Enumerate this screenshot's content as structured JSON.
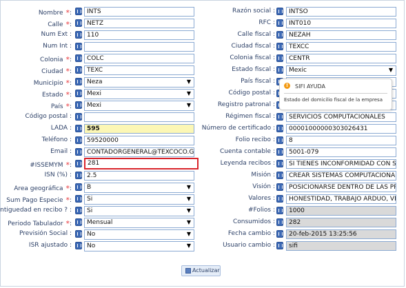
{
  "left": [
    {
      "label": "Nombre",
      "required": true,
      "type": "text",
      "value": "INTS"
    },
    {
      "label": "Calle",
      "required": true,
      "type": "text",
      "value": "NETZ"
    },
    {
      "label": "Num Ext",
      "required": false,
      "type": "text",
      "value": "110"
    },
    {
      "label": "Num Int",
      "required": false,
      "type": "text",
      "value": ""
    },
    {
      "label": "Colonia",
      "required": true,
      "type": "text",
      "value": "COLC"
    },
    {
      "label": "Ciudad",
      "required": true,
      "type": "text",
      "value": "TEXC"
    },
    {
      "label": "Municipio",
      "required": true,
      "type": "select",
      "value": "Neza"
    },
    {
      "label": "Estado",
      "required": true,
      "type": "select",
      "value": "Mexi"
    },
    {
      "label": "País",
      "required": true,
      "type": "select",
      "value": "Mexi"
    },
    {
      "label": "Código postal",
      "required": false,
      "type": "text",
      "value": ""
    },
    {
      "label": "LADA",
      "required": false,
      "type": "text",
      "value": "595",
      "style": "yellow"
    },
    {
      "label": "Teléfono",
      "required": false,
      "type": "text",
      "value": "59520000"
    },
    {
      "label": "Email",
      "required": false,
      "type": "text",
      "value": "CONTADORGENERAL@TEXCOCO.GOB"
    },
    {
      "label": "#ISSEMYM",
      "required": true,
      "type": "text",
      "value": "281",
      "style": "red"
    },
    {
      "label": "ISN (%)",
      "required": false,
      "type": "text",
      "value": "2.5"
    },
    {
      "label": "Area geográfica",
      "required": true,
      "type": "select",
      "value": "B"
    },
    {
      "label": "Sum Pago Especie",
      "required": true,
      "type": "select",
      "value": "Si"
    },
    {
      "label": "Antiguedad en recibo ?",
      "required": false,
      "type": "select",
      "value": "Si"
    },
    {
      "label": "Periodo Tabulador",
      "required": true,
      "type": "select",
      "value": "Mensual"
    },
    {
      "label": "Previsión Social",
      "required": false,
      "type": "select",
      "value": "No"
    },
    {
      "label": "ISR ajustado",
      "required": false,
      "type": "select",
      "value": "No"
    }
  ],
  "right": [
    {
      "label": "Razón social",
      "type": "text",
      "value": "INTSO"
    },
    {
      "label": "RFC",
      "type": "text",
      "value": "INT010"
    },
    {
      "label": "Calle fiscal",
      "type": "text",
      "value": "NEZAH"
    },
    {
      "label": "Ciudad fiscal",
      "type": "text",
      "value": "TEXCC"
    },
    {
      "label": "Colonia fiscal",
      "type": "text",
      "value": "CENTR"
    },
    {
      "label": "Estado fiscal",
      "type": "select",
      "value": "Mexic"
    },
    {
      "label": "País fiscal",
      "type": "text",
      "value": ""
    },
    {
      "label": "Código postal",
      "type": "text",
      "value": ""
    },
    {
      "label": "Registro patronal",
      "type": "text",
      "value": ""
    },
    {
      "label": "Régimen fiscal",
      "type": "text",
      "value": "SERVICIOS COMPUTACIONALES"
    },
    {
      "label": "Número de certificado",
      "type": "text",
      "value": "00001000000303026431"
    },
    {
      "label": "Folio recibo",
      "type": "text",
      "value": "8"
    },
    {
      "label": "Cuenta contable",
      "type": "text",
      "value": "5001-079"
    },
    {
      "label": "Leyenda recibos",
      "type": "text",
      "value": "SI TIENES INCONFORMIDAD CON SE"
    },
    {
      "label": "Misión",
      "type": "text",
      "value": "CREAR SISTEMAS COMPUTACIONALE"
    },
    {
      "label": "Visión",
      "type": "text",
      "value": "POSICIONARSE DENTRO DE LAS PRI"
    },
    {
      "label": "Valores",
      "type": "text",
      "value": "HONESTIDAD, TRABAJO ARDUO, VER"
    },
    {
      "label": "#Folios",
      "type": "text",
      "value": "1000",
      "style": "gray"
    },
    {
      "label": "Consumidos",
      "type": "text",
      "value": "282",
      "style": "gray"
    },
    {
      "label": "Fecha cambio",
      "type": "text",
      "value": "20-feb-2015 13:25:56",
      "style": "gray"
    },
    {
      "label": "Usuario cambio",
      "type": "text",
      "value": "sifi",
      "style": "gray"
    }
  ],
  "tooltip": {
    "title": "SIFI AYUDA",
    "text": "Estado del domicilio fiscal de la empresa",
    "icon": "exclamation-icon"
  },
  "button": {
    "label": "Actualizar",
    "icon": "save-icon"
  },
  "colors": {
    "label": "#2b3f66",
    "required": "#e8363b",
    "highlight": "#d9232a",
    "lada": "#fcf7b5",
    "readonly": "#d9d9d9"
  }
}
